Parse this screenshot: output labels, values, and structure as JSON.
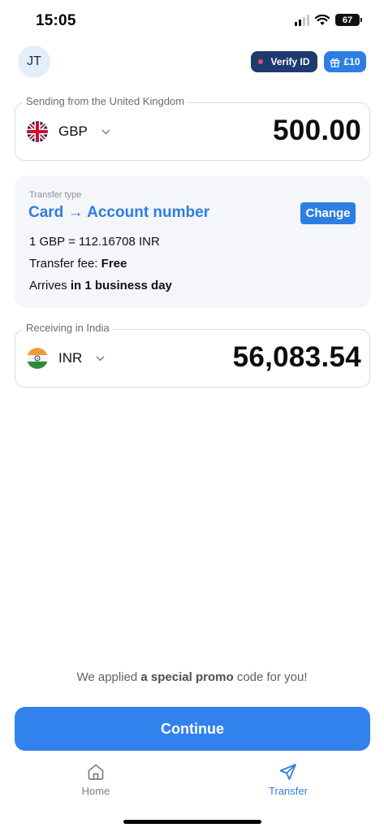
{
  "status_bar": {
    "time": "15:05",
    "battery": "67"
  },
  "header": {
    "avatar_initials": "JT",
    "verify_label": "Verify ID",
    "reward_label": "£10"
  },
  "sending": {
    "legend": "Sending from the United Kingdom",
    "currency": "GBP",
    "amount": "500.00"
  },
  "transfer": {
    "type_label": "Transfer type",
    "type_value": "Card → Account number",
    "change_label": "Change",
    "rate": "1 GBP = 112.16708 INR",
    "fee_label": "Transfer fee:",
    "fee_value": "Free",
    "arrives_label": "Arrives",
    "arrives_value": "in 1 business day"
  },
  "receiving": {
    "legend": "Receiving in India",
    "currency": "INR",
    "amount": "56,083.54"
  },
  "promo": {
    "prefix": "We applied",
    "highlight": "a special promo",
    "suffix": "code for you!"
  },
  "continue_label": "Continue",
  "tabs": [
    {
      "label": "Home",
      "icon": "home-icon",
      "active": false
    },
    {
      "label": "Transfer",
      "icon": "send-icon",
      "active": true
    }
  ],
  "colors": {
    "accent": "#2e7de3",
    "verify_bg": "#1f3a6e",
    "card_bg": "#f4f6f9",
    "tab_inactive": "#7a7f88"
  }
}
